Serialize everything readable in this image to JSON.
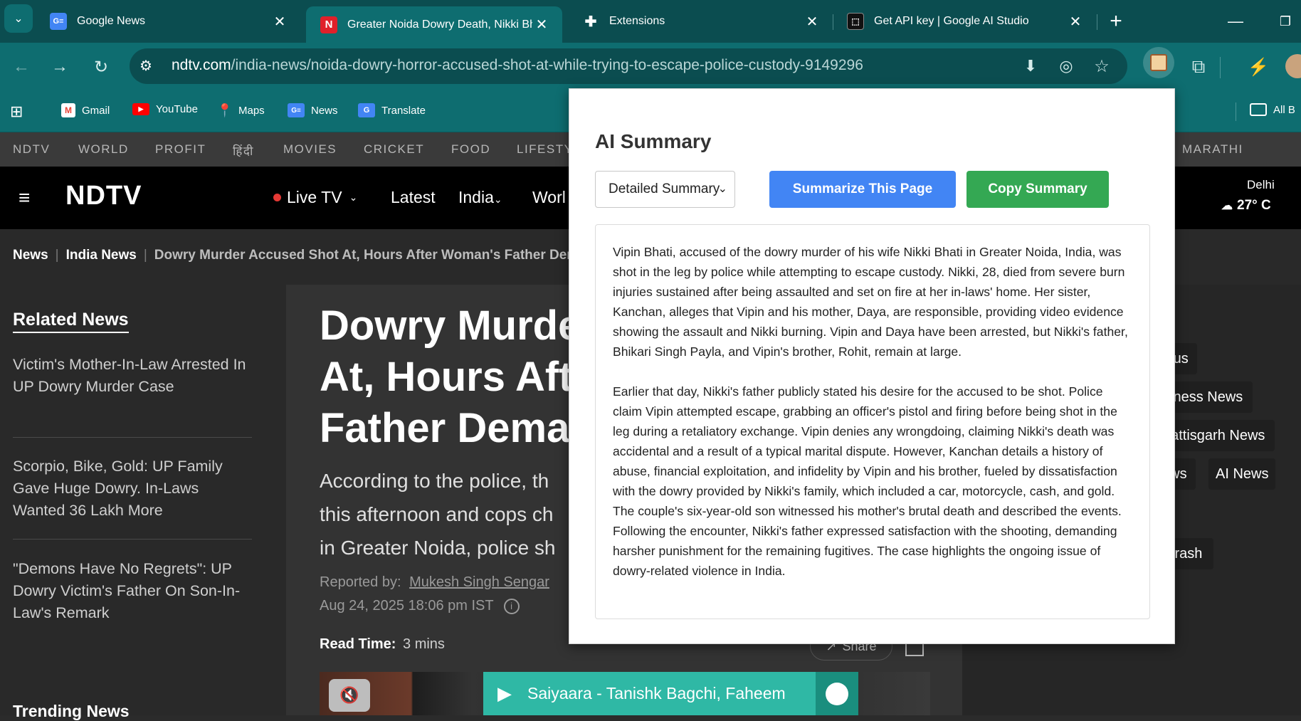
{
  "browser": {
    "tabs": [
      {
        "title": "Google News",
        "favicon": "google-news-icon",
        "active": false
      },
      {
        "title": "Greater Noida Dowry Death, Nikki Bha",
        "favicon": "ndtv-icon",
        "active": true
      },
      {
        "title": "Extensions",
        "favicon": "puzzle-icon",
        "active": false
      },
      {
        "title": "Get API key | Google AI Studio",
        "favicon": "ai-studio-icon",
        "active": false
      }
    ],
    "url_domain": "ndtv.com",
    "url_path": "/india-news/noida-dowry-horror-accused-shot-at-while-trying-to-escape-police-custody-9149296",
    "bookmarks": [
      {
        "label": "Gmail",
        "color": "#ea4335"
      },
      {
        "label": "YouTube",
        "color": "#ff0000"
      },
      {
        "label": "Maps",
        "color": "#34a853"
      },
      {
        "label": "News",
        "color": "#4285f4"
      },
      {
        "label": "Translate",
        "color": "#4285f4"
      }
    ],
    "all_bookmarks": "All B"
  },
  "site": {
    "categories": [
      "NDTV",
      "WORLD",
      "PROFIT",
      "हिंदी",
      "MOVIES",
      "CRICKET",
      "FOOD",
      "LIFESTY",
      "MARATHI"
    ],
    "logo": "NDTV",
    "main_nav": [
      "Live TV",
      "Latest",
      "India",
      "Worl"
    ],
    "weather_city": "Delhi",
    "weather_temp": "27° C",
    "breadcrumb": [
      "News",
      "India News",
      "Dowry Murder Accused Shot At, Hours After Woman's Father Der"
    ],
    "related_heading": "Related News",
    "related": [
      "Victim's Mother-In-Law Arrested In UP Dowry Murder Case",
      "Scorpio, Bike, Gold: UP Family Gave Huge Dowry. In-Laws Wanted 36 Lakh More",
      "\"Demons Have No Regrets\": UP Dowry Victim's Father On Son-In-Law's Remark"
    ],
    "trending_heading": "Trending News",
    "headline_lines": [
      "Dowry Murde",
      "At, Hours Aft",
      "Father Dema"
    ],
    "sub_lines": [
      "According to the police, th",
      "this afternoon and cops ch",
      "in Greater Noida, police sh"
    ],
    "reported_by_label": "Reported by:",
    "author": "Mukesh Singh Sengar",
    "date": "Aug 24, 2025 18:06 pm IST",
    "read_time_label": "Read Time:",
    "read_time": "3 mins",
    "share": "Share",
    "tags": [
      "atus",
      "siness News",
      "hattisgarh News",
      "ews",
      "AI News",
      "Crash"
    ],
    "player_song": "Saiyaara - Tanishk Bagchi, Faheem Ab"
  },
  "popup": {
    "title": "AI Summary",
    "select_value": "Detailed Summary",
    "summarize_label": "Summarize This Page",
    "copy_label": "Copy Summary",
    "summarize_color": "#4285f4",
    "copy_color": "#34a853",
    "paragraphs": [
      "Vipin Bhati, accused of the dowry murder of his wife Nikki Bhati in Greater Noida, India, was shot in the leg by police while attempting to escape custody.  Nikki, 28, died from severe burn injuries sustained after being assaulted and set on fire at her in-laws' home.  Her sister, Kanchan, alleges that Vipin and his mother, Daya, are responsible, providing video evidence showing the assault and Nikki burning.  Vipin and Daya have been arrested, but Nikki's father, Bhikari Singh Payla, and Vipin's brother, Rohit, remain at large.",
      "Earlier that day, Nikki's father publicly stated his desire for the accused to be shot.  Police claim Vipin attempted escape, grabbing an officer's pistol and firing before being shot in the leg during a retaliatory exchange.  Vipin denies any wrongdoing, claiming Nikki's death was accidental and a result of a typical marital dispute.  However, Kanchan details a history of abuse, financial exploitation, and infidelity by Vipin and his brother, fueled by dissatisfaction with the dowry provided by Nikki's family, which included a car, motorcycle, cash, and gold.  The couple's six-year-old son witnessed his mother's brutal death and described the events.  Following the encounter, Nikki's father expressed satisfaction with the shooting, demanding harsher punishment for the remaining fugitives.  The case highlights the ongoing issue of dowry-related violence in India."
    ]
  }
}
